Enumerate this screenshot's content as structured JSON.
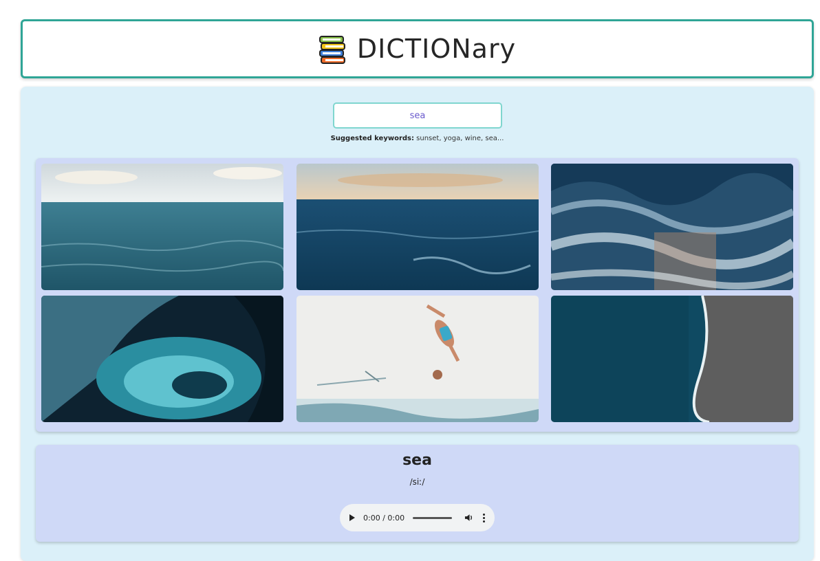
{
  "header": {
    "title": "DICTIONary"
  },
  "search": {
    "value": "sea"
  },
  "suggestions": {
    "label": "Suggested keywords:",
    "text": "sunset, yoga, wine, sea..."
  },
  "gallery": {
    "images": [
      {
        "name": "sea-horizon-image"
      },
      {
        "name": "ocean-waves-sunset-image"
      },
      {
        "name": "aerial-waves-image"
      },
      {
        "name": "curling-wave-image"
      },
      {
        "name": "person-diving-image"
      },
      {
        "name": "aerial-beach-image"
      }
    ]
  },
  "entry": {
    "word": "sea",
    "phonetic": "/siː/"
  },
  "audio": {
    "time": "0:00 / 0:00"
  }
}
